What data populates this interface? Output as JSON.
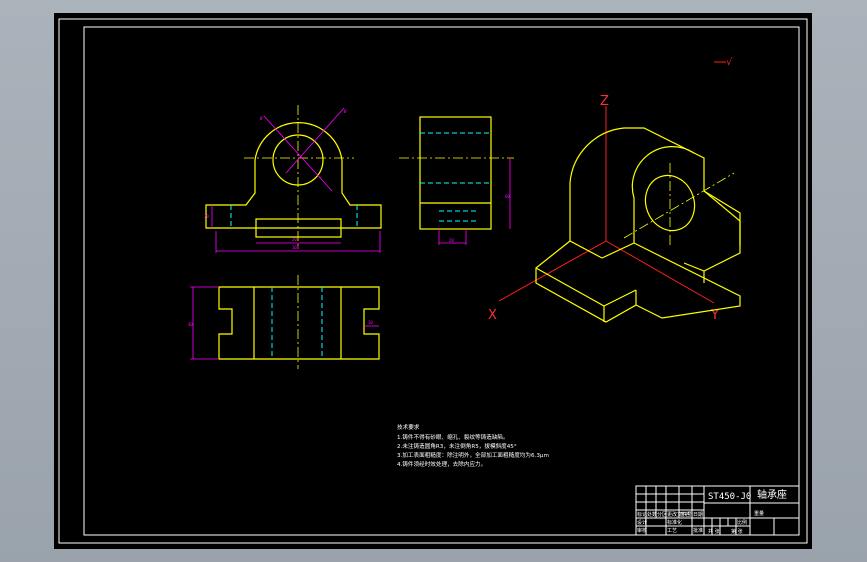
{
  "drawing": {
    "mark": "√",
    "axes": {
      "z": "Z",
      "x": "X",
      "y": "Y"
    },
    "dimensions": {
      "dia_top_left": "Ø",
      "dia_top_right": "Ø",
      "height_left": "20",
      "slot_width": "20",
      "overall_width": "100",
      "side_height": "60",
      "side_base": "20",
      "plan_depth": "40",
      "plan_notch": "10"
    },
    "notes": {
      "title": "技术要求",
      "line1": "1.铸件不得有砂眼、缩孔、裂纹等铸造缺陷。",
      "line2": "2.未注铸造圆角R3，未注倒角R5，拔模斜度45°",
      "line3": "3.加工表面粗糙度：除注明外，全部加工面粗糙度均为6.3μm",
      "line4": "4.铸件须经时效处理，去除内应力。"
    },
    "title_block": {
      "drawing_number": "ST450-J0",
      "part_name": "轴承座",
      "cell_marks": [
        "标记",
        "处数",
        "分区",
        "更改文件号",
        "签名",
        "日期"
      ],
      "row_labels": [
        "设计",
        "审核",
        "工艺",
        "标准化",
        "批准"
      ],
      "scale_label": "比例",
      "weight_label": "重量",
      "sheet_label": "共 张",
      "page_label": "第 张"
    }
  }
}
